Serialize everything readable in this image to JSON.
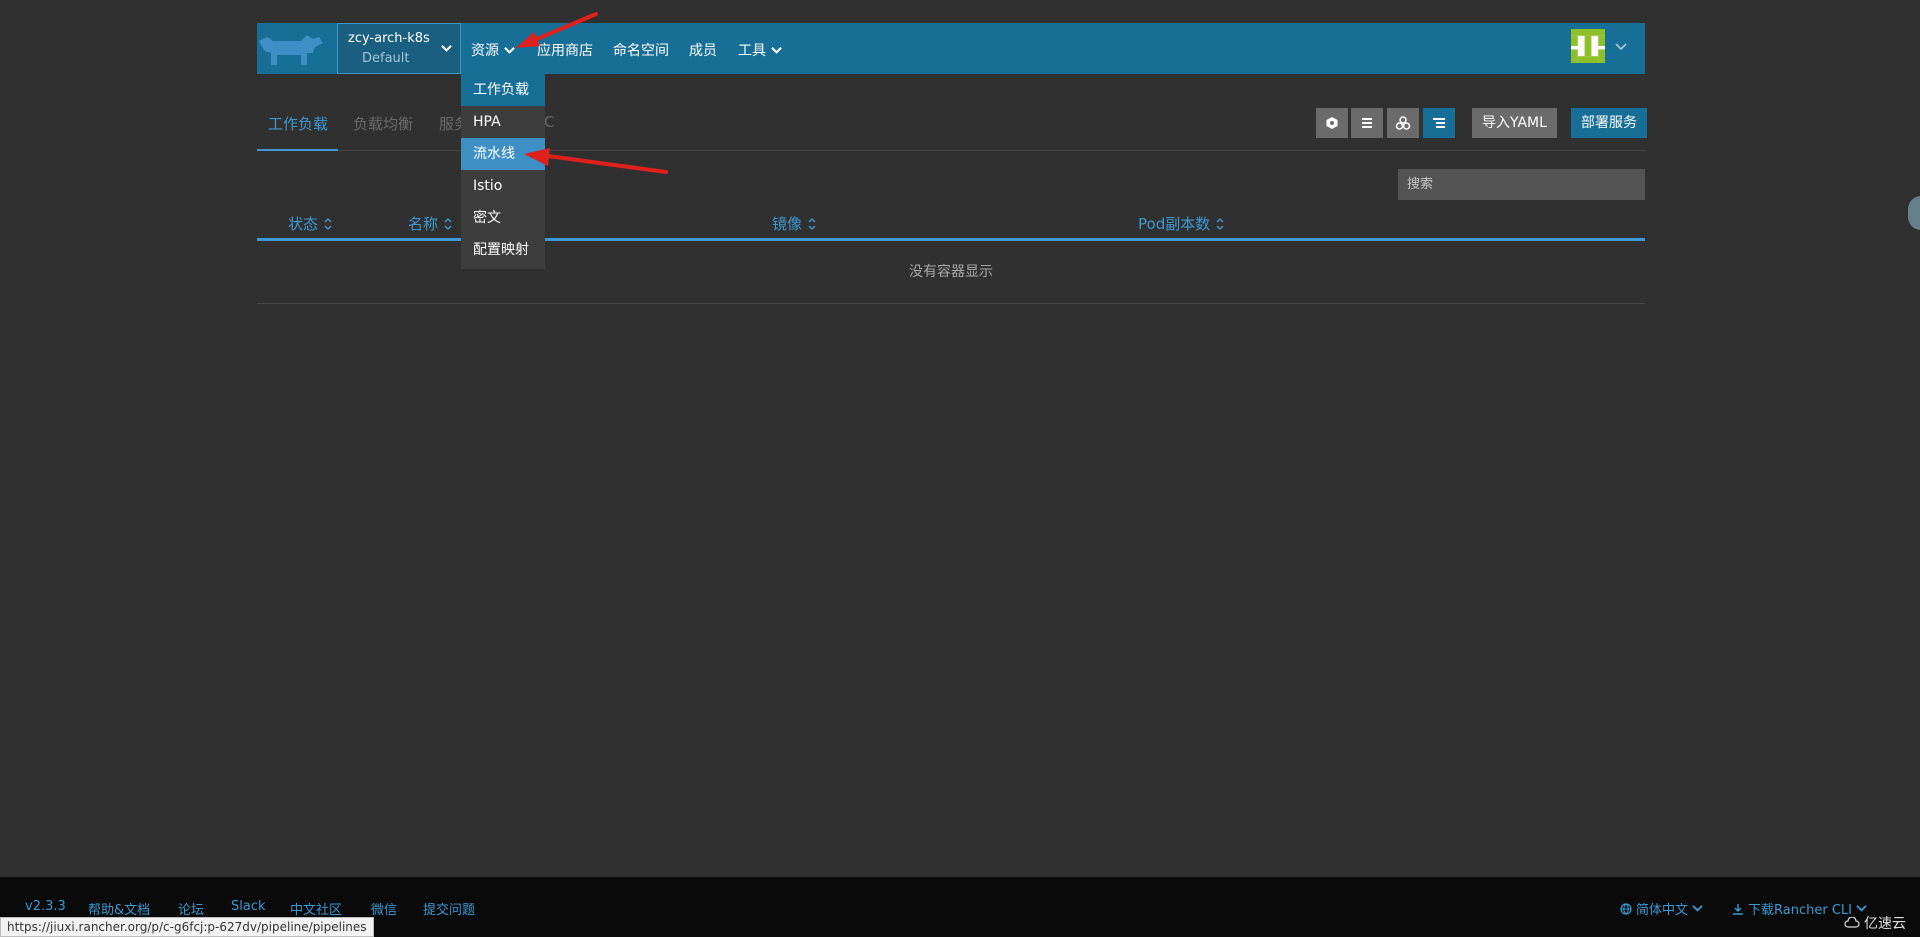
{
  "header": {
    "cluster_name": "zcy-arch-k8s",
    "project_name": "Default",
    "nav": {
      "resources": "资源",
      "app_store": "应用商店",
      "namespaces": "命名空间",
      "members": "成员",
      "tools": "工具"
    }
  },
  "dropdown": {
    "items": [
      "工作负载",
      "HPA",
      "流水线",
      "Istio",
      "密文",
      "配置映射"
    ],
    "highlighted": "流水线"
  },
  "tabs": {
    "workloads": "工作负载",
    "load_balancing": "负载均衡",
    "service_partial": "服务",
    "pvc_partial": "C"
  },
  "actions": {
    "import_yaml": "导入YAML",
    "deploy": "部署服务"
  },
  "search": {
    "placeholder": "搜索"
  },
  "table": {
    "columns": {
      "state": "状态",
      "name": "名称",
      "image": "镜像",
      "pods": "Pod副本数"
    },
    "empty_text": "没有容器显示"
  },
  "footer": {
    "version": "v2.3.3",
    "help_docs": "帮助&文档",
    "forum": "论坛",
    "slack": "Slack",
    "cn_community": "中文社区",
    "wechat": "微信",
    "report_issue": "提交问题",
    "language": "简体中文",
    "download_cli": "下载Rancher CLI",
    "watermark": "亿速云"
  },
  "status_url": "https://jiuxi.rancher.org/p/c-g6fcj:p-627dv/pipeline/pipelines",
  "colors": {
    "header_bg": "#176e96",
    "accent": "#3d98d3",
    "page_bg": "#303030",
    "annotation_arrow": "#e0201b"
  }
}
